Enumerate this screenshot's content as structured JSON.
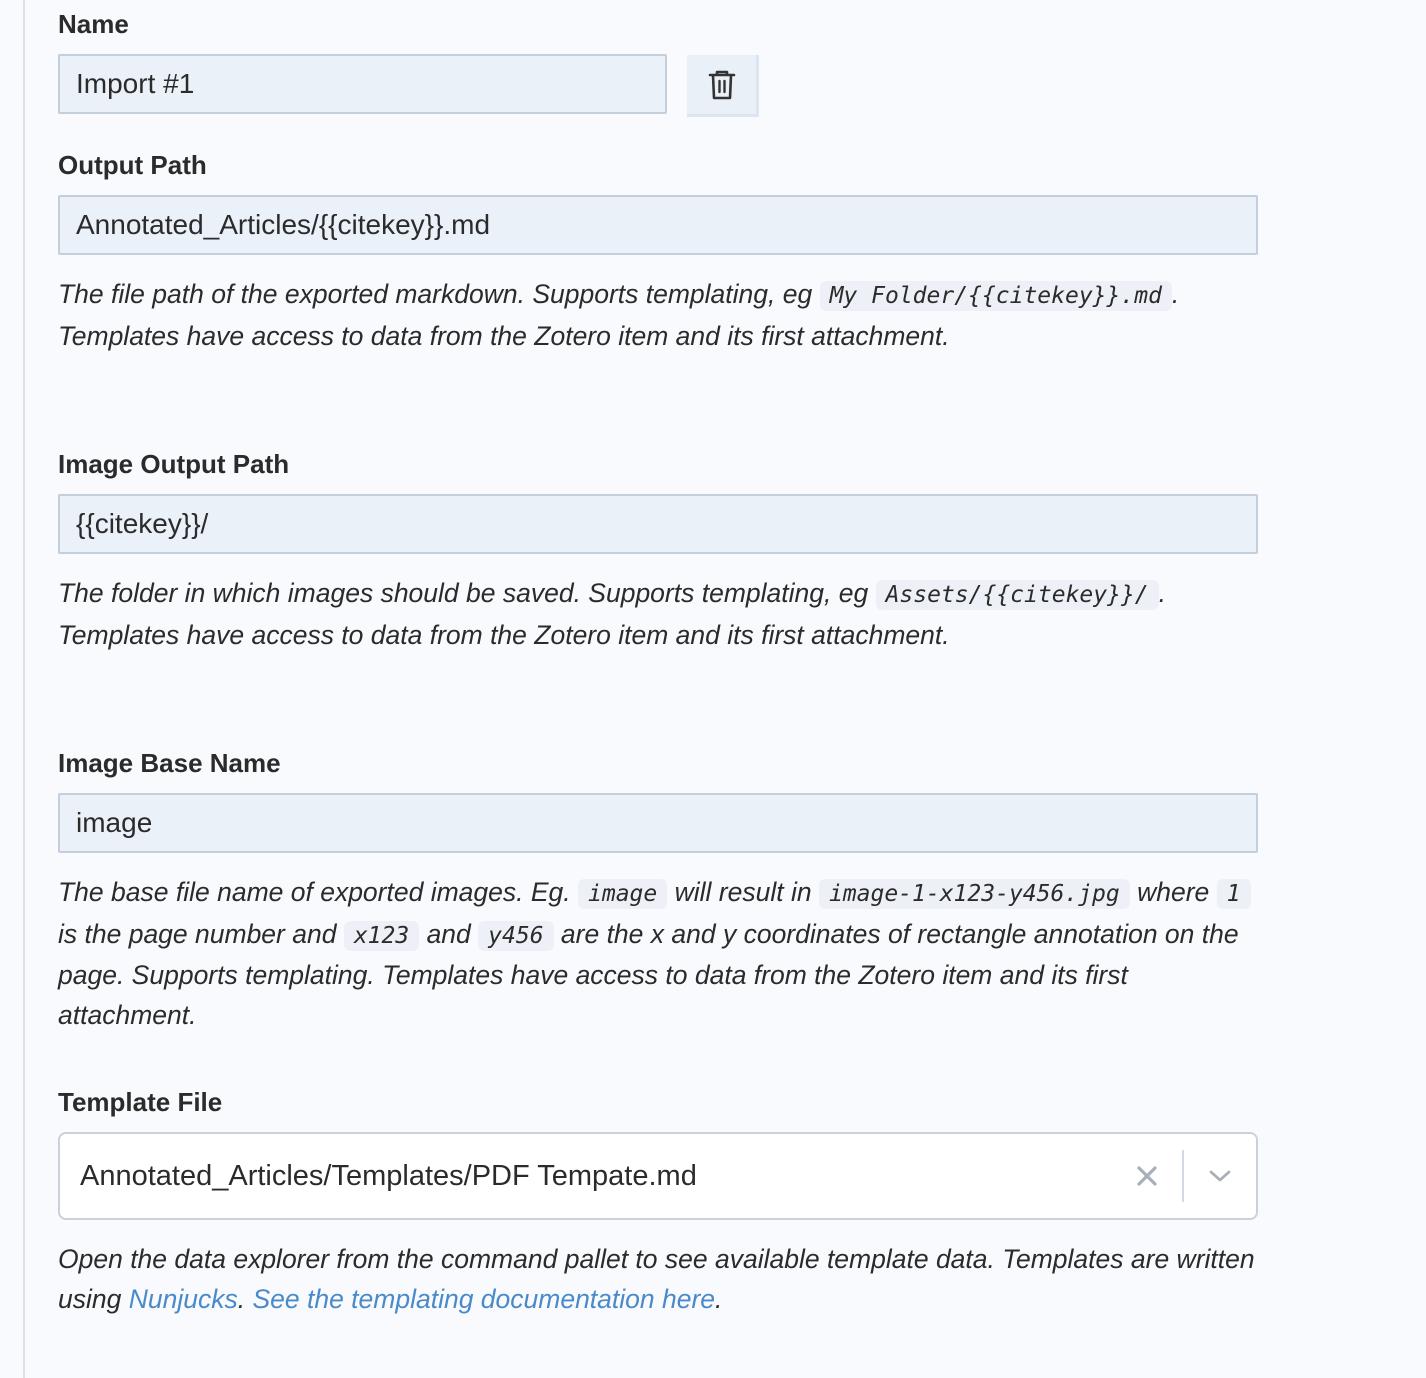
{
  "name_field": {
    "label": "Name",
    "value": "Import #1",
    "delete_icon": "trash-icon"
  },
  "output_path": {
    "label": "Output Path",
    "value": "Annotated_Articles/{{citekey}}.md",
    "desc_before": "The file path of the exported markdown. Supports templating, eg ",
    "desc_code": "My Folder/{{citekey}}.md",
    "desc_after": ". Templates have access to data from the Zotero item and its first attachment."
  },
  "image_output_path": {
    "label": "Image Output Path",
    "value": "{{citekey}}/",
    "desc_before": "The folder in which images should be saved. Supports templating, eg ",
    "desc_code": "Assets/{{citekey}}/",
    "desc_after": ". Templates have access to data from the Zotero item and its first attachment."
  },
  "image_base_name": {
    "label": "Image Base Name",
    "value": "image",
    "desc_1": "The base file name of exported images. Eg. ",
    "code_1": "image",
    "desc_2": " will result in ",
    "code_2": "image-1-x123-y456.jpg",
    "desc_3": " where ",
    "code_3": "1",
    "desc_4": " is the page number and ",
    "code_4": "x123",
    "desc_5": " and ",
    "code_5": "y456",
    "desc_6": " are the x and y coordinates of rectangle annotation on the page. Supports templating. Templates have access to data from the Zotero item and its first attachment."
  },
  "template_file": {
    "label": "Template File",
    "value": "Annotated_Articles/Templates/PDF Tempate.md",
    "clear_icon": "close-icon",
    "dropdown_icon": "chevron-down-icon",
    "desc_before": "Open the data explorer from the command pallet to see available template data. Templates are written using ",
    "link_1": "Nunjucks",
    "desc_mid": ". ",
    "link_2": "See the templating documentation here",
    "desc_after": "."
  },
  "colors": {
    "input_bg": "#ebf1f9",
    "link": "#4a8ac9",
    "text": "#2b2b2b"
  }
}
